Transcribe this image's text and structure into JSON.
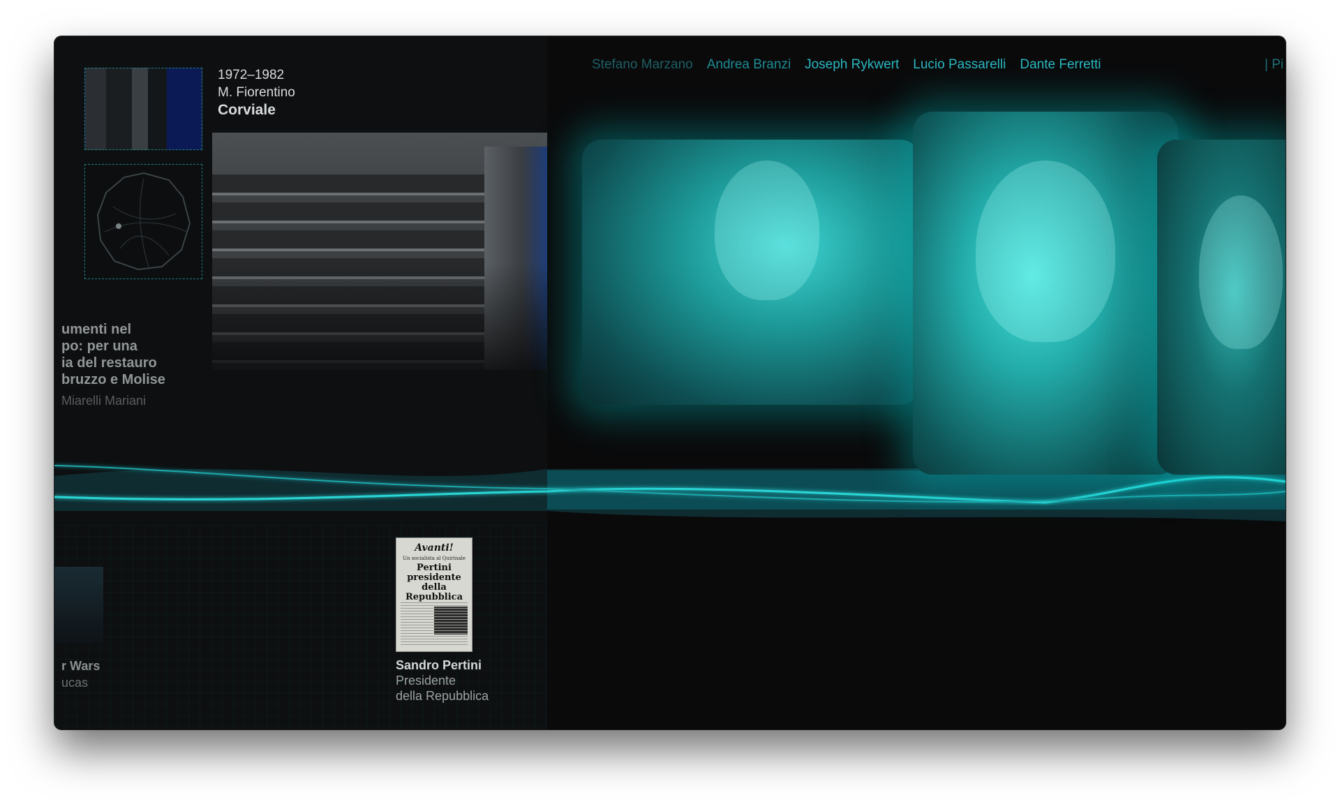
{
  "card": {
    "years": "1972–1982",
    "author": "M. Fiorentino",
    "title": "Corviale"
  },
  "side_card": {
    "title_lines": [
      "umenti nel",
      "po: per una",
      "ia del restauro",
      "bruzzo e Molise"
    ],
    "author": "Miarelli Mariani"
  },
  "nav": {
    "people": [
      "Stefano Marzano",
      "Andrea Branzi",
      "Joseph Rykwert",
      "Lucio Passarelli",
      "Dante Ferretti"
    ],
    "trailing": "| Pi"
  },
  "newspaper": {
    "masthead": "Avanti!",
    "subhead": "Un socialista al Quirinale",
    "headline": "Pertini presidente della Repubblica"
  },
  "timeline_cards": [
    {
      "title": "Sandro Pertini",
      "subtitle_1": "Presidente",
      "subtitle_2": "della Repubblica"
    },
    {
      "title": "r Wars",
      "subtitle_1": "ucas"
    }
  ],
  "colors": {
    "accent": "#2bd6d6",
    "background": "#0a0a0b"
  }
}
